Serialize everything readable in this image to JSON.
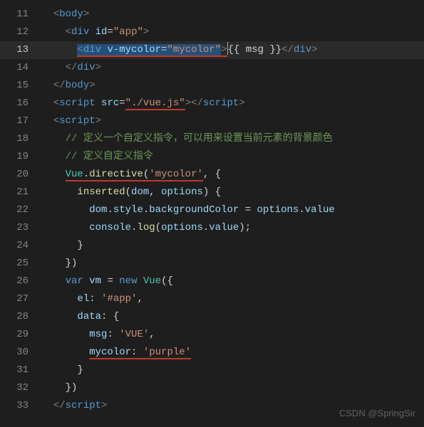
{
  "lineNumbers": [
    "11",
    "12",
    "13",
    "14",
    "15",
    "16",
    "17",
    "18",
    "19",
    "20",
    "21",
    "22",
    "23",
    "24",
    "25",
    "26",
    "27",
    "28",
    "29",
    "30",
    "31",
    "32",
    "33"
  ],
  "code": {
    "l11": {
      "open": "<",
      "tag": "body",
      "close": ">"
    },
    "l12": {
      "open": "<",
      "tag": "div",
      "attr": "id",
      "eq": "=",
      "val": "\"app\"",
      "close": ">"
    },
    "l13": {
      "open": "<",
      "tag": "div",
      "attr": "v-mycolor",
      "eq": "=",
      "val": "\"mycolor\"",
      "close": ">",
      "text": "{{ msg }}",
      "endopen": "</",
      "endtag": "div",
      "endclose": ">"
    },
    "l14": {
      "open": "</",
      "tag": "div",
      "close": ">"
    },
    "l15": {
      "open": "</",
      "tag": "body",
      "close": ">"
    },
    "l16": {
      "open": "<",
      "tag": "script",
      "attr": "src",
      "eq": "=",
      "val": "\"./vue.js\"",
      "close": ">",
      "endopen": "</",
      "endtag": "script",
      "endclose": ">"
    },
    "l17": {
      "open": "<",
      "tag": "script",
      "close": ">"
    },
    "l18": {
      "comment": "// 定义一个自定义指令，可以用来设置当前元素的背景颜色"
    },
    "l19": {
      "comment": "// 定义自定义指令"
    },
    "l20": {
      "obj": "Vue",
      "dot": ".",
      "fn": "directive",
      "call": "(",
      "str": "'mycolor'",
      "comma": ", {"
    },
    "l21": {
      "fn": "inserted",
      "sig": "(",
      "p1": "dom",
      "c": ", ",
      "p2": "options",
      "close": ") {"
    },
    "l22": {
      "v1": "dom",
      "d1": ".",
      "v2": "style",
      "d2": ".",
      "v3": "backgroundColor",
      "eq": " = ",
      "v4": "options",
      "d3": ".",
      "v5": "value"
    },
    "l23": {
      "obj": "console",
      "dot": ".",
      "fn": "log",
      "open": "(",
      "v1": "options",
      "d1": ".",
      "v2": "value",
      "close": ");"
    },
    "l24": {
      "brace": "}"
    },
    "l25": {
      "end": "})"
    },
    "l26": {
      "kw": "var",
      "sp": " ",
      "v": "vm",
      "eq": " = ",
      "nw": "new",
      "sp2": " ",
      "cls": "Vue",
      "open": "({"
    },
    "l27": {
      "key": "el",
      "colon": ": ",
      "val": "'#app'",
      "comma": ","
    },
    "l28": {
      "key": "data",
      "colon": ": {"
    },
    "l29": {
      "key": "msg",
      "colon": ": ",
      "val": "'VUE'",
      "comma": ","
    },
    "l30": {
      "key": "mycolor",
      "colon": ": ",
      "val": "'purple'"
    },
    "l31": {
      "brace": "}"
    },
    "l32": {
      "end": "})"
    },
    "l33": {
      "open": "</",
      "tag": "script",
      "close": ">"
    }
  },
  "watermark": "CSDN @SpringSir"
}
